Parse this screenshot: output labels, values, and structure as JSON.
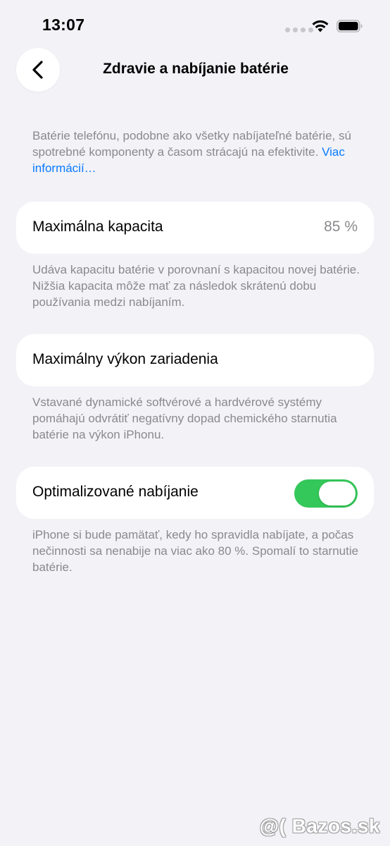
{
  "status_bar": {
    "time": "13:07"
  },
  "header": {
    "title": "Zdravie a nabíjanie batérie",
    "back_icon": "chevron-left-icon"
  },
  "intro": {
    "text": "Batérie telefónu, podobne ako všetky nabíjateľné batérie, sú spotrebné komponenty a časom strácajú na efektivite. ",
    "link_label": "Viac informácií…"
  },
  "max_capacity": {
    "label": "Maximálna kapacita",
    "value": "85 %",
    "footer": "Udáva kapacitu batérie v porovnaní s kapacitou novej batérie. Nižšia kapacita môže mať za následok skrátenú dobu používania medzi nabíjaním."
  },
  "peak_performance": {
    "label": "Maximálny výkon zariadenia",
    "footer": "Vstavané dynamické softvérové a hardvérové systémy pomáhajú odvrátiť negatívny dopad chemického starnutia batérie na výkon iPhonu."
  },
  "optimized_charging": {
    "label": "Optimalizované nabíjanie",
    "enabled": true,
    "footer": "iPhone si bude pamätať, kedy ho spravidla nabíjate, a počas nečinnosti sa nenabije na viac ako 80 %. Spomalí to starnutie batérie."
  },
  "colors": {
    "background": "#f2f2f7",
    "accent_link": "#0a7aff",
    "toggle_on": "#34c759",
    "secondary_text": "#8a8a8e"
  },
  "watermark": {
    "text": "@( Bazos.sk"
  }
}
